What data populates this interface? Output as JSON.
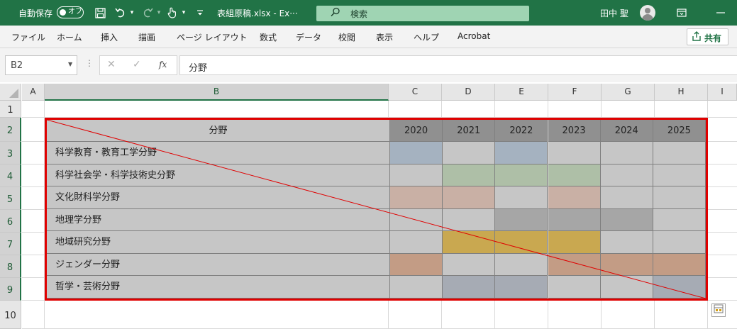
{
  "titlebar": {
    "autosave_label": "自動保存",
    "autosave_state": "オフ",
    "filename": "表組原稿.xlsx  -  Ex···",
    "search_placeholder": "検索",
    "user_name": "田中 聖",
    "accent_color": "#217346"
  },
  "ribbon": {
    "tabs": [
      "ファイル",
      "ホーム",
      "挿入",
      "描画",
      "ページ レイアウト",
      "数式",
      "データ",
      "校閲",
      "表示",
      "ヘルプ",
      "Acrobat"
    ],
    "share_label": "共有"
  },
  "formula_bar": {
    "name_box": "B2",
    "fx_label": "fx",
    "formula": "分野"
  },
  "sheet": {
    "columns": [
      "A",
      "B",
      "C",
      "D",
      "E",
      "F",
      "G",
      "H",
      "I"
    ],
    "selected_column": "B",
    "rows": [
      "1",
      "2",
      "3",
      "4",
      "5",
      "6",
      "7",
      "8",
      "9",
      "10"
    ],
    "selected_rows": [
      "2",
      "3",
      "4",
      "5",
      "6",
      "7",
      "8",
      "9"
    ]
  },
  "table": {
    "corner_label": "分野",
    "years": [
      "2020",
      "2021",
      "2022",
      "2023",
      "2024",
      "2025"
    ],
    "fields": [
      "科学教育・教育工学分野",
      "科学社会学・科学技術史分野",
      "文化財科学分野",
      "地理学分野",
      "地域研究分野",
      "ジェンダー分野",
      "哲学・芸術分野"
    ],
    "header_color": "#909090",
    "default_cell_color": "#c6c6c6",
    "cell_colors": [
      [
        "#a5b2c0",
        "#c6c6c6",
        "#a5b2c0",
        "#c6c6c6",
        "#c6c6c6",
        "#c6c6c6"
      ],
      [
        "#c6c6c6",
        "#aebfa7",
        "#aebfa7",
        "#aebfa7",
        "#c6c6c6",
        "#c6c6c6"
      ],
      [
        "#c9b0a5",
        "#c9b0a5",
        "#c6c6c6",
        "#c9b0a5",
        "#c6c6c6",
        "#c6c6c6"
      ],
      [
        "#c6c6c6",
        "#c6c6c6",
        "#a6a6a6",
        "#a6a6a6",
        "#a6a6a6",
        "#c6c6c6"
      ],
      [
        "#c6c6c6",
        "#c9a850",
        "#c9a850",
        "#c9a850",
        "#c6c6c6",
        "#c6c6c6"
      ],
      [
        "#c39c85",
        "#c6c6c6",
        "#c6c6c6",
        "#c39c85",
        "#c39c85",
        "#c39c85"
      ],
      [
        "#c6c6c6",
        "#a6abb4",
        "#a6abb4",
        "#c6c6c6",
        "#c6c6c6",
        "#a6abb4"
      ]
    ],
    "border_color": "#e00000",
    "diagonal_color": "#e00000"
  }
}
